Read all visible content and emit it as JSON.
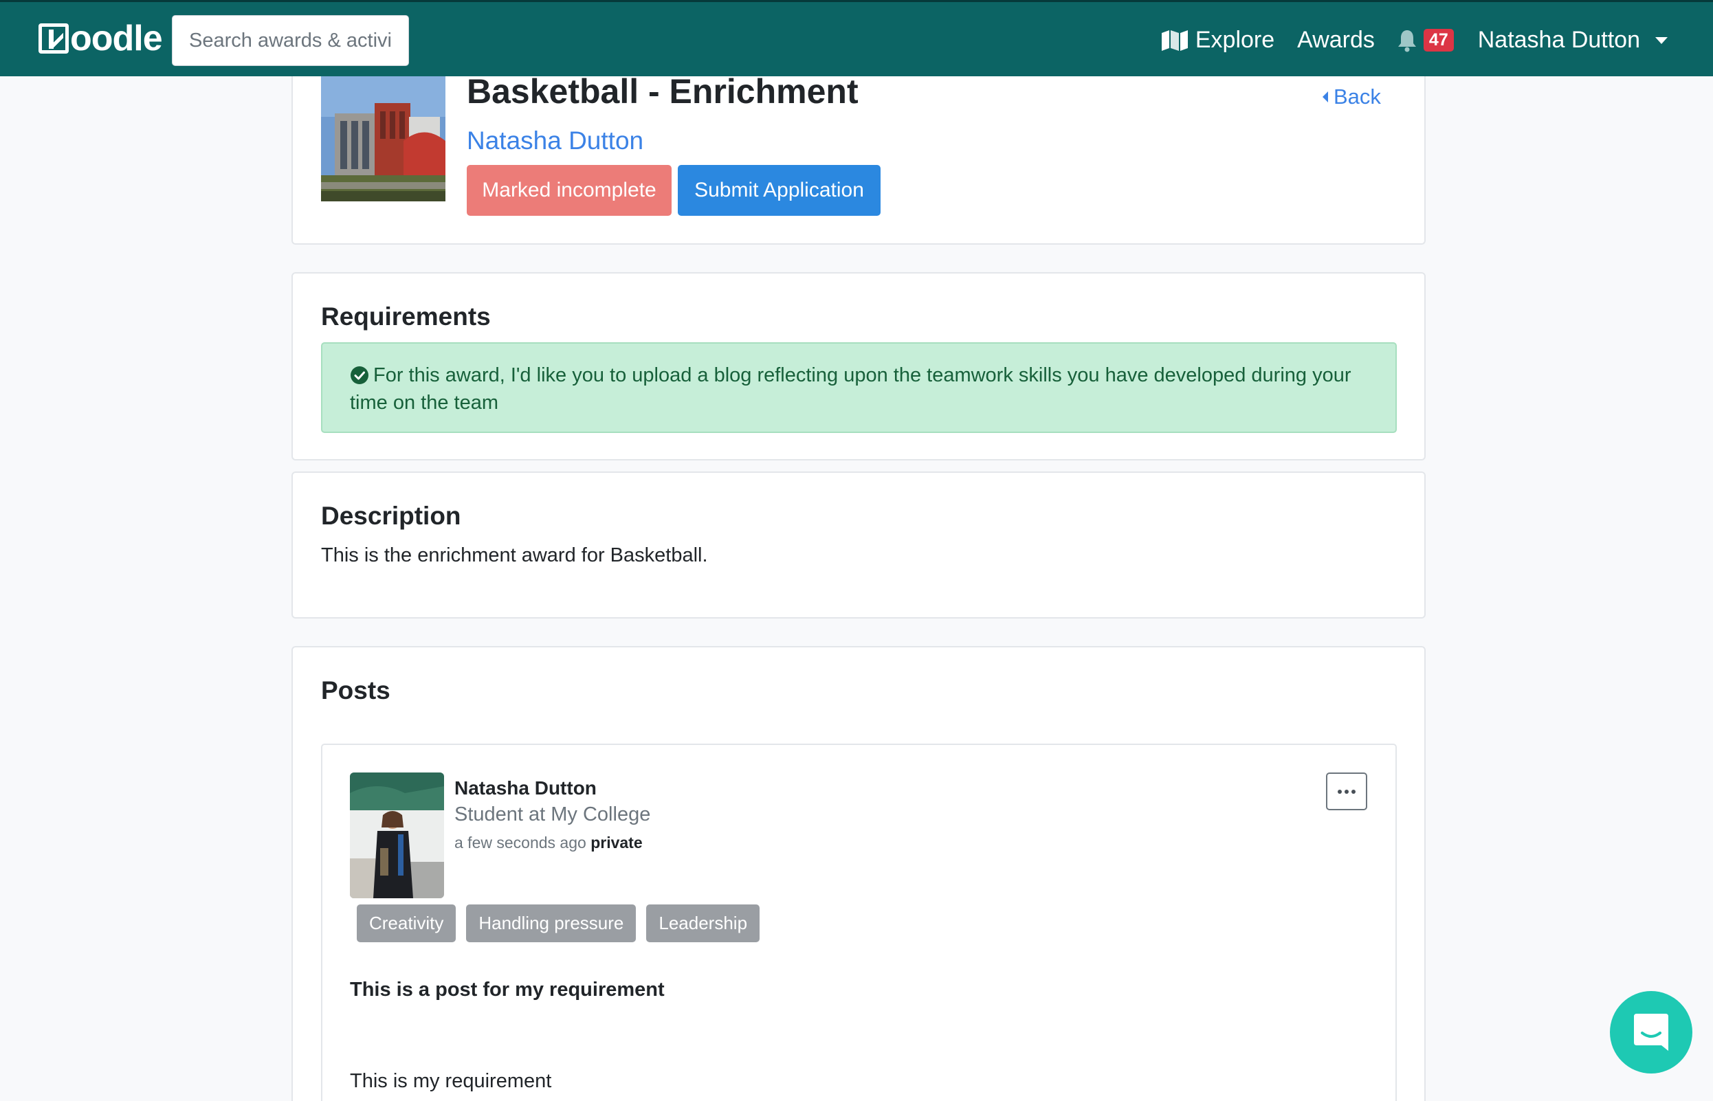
{
  "navbar": {
    "logo": "Kloodle",
    "search_placeholder": "Search awards & activities",
    "explore_label": "Explore",
    "awards_label": "Awards",
    "notification_count": "47",
    "user_name": "Natasha Dutton"
  },
  "award": {
    "title": "Basketball - Enrichment",
    "owner": "Natasha Dutton",
    "status_button": "Marked incomplete",
    "submit_button": "Submit Application",
    "back_label": "Back"
  },
  "requirements": {
    "heading": "Requirements",
    "items": [
      {
        "text": "For this award, I'd like you to upload a blog reflecting upon the teamwork skills you have developed during your time on the team",
        "completed": true
      }
    ]
  },
  "description": {
    "heading": "Description",
    "text": "This is the enrichment award for Basketball."
  },
  "posts": {
    "heading": "Posts",
    "items": [
      {
        "author": "Natasha Dutton",
        "role": "Student at My College",
        "time": "a few seconds ago",
        "visibility": "private",
        "tags": [
          "Creativity",
          "Handling pressure",
          "Leadership"
        ],
        "title": "This is a post for my requirement",
        "body": "This is my requirement"
      }
    ]
  },
  "colors": {
    "navbar": "#0c6464",
    "primary": "#2b88e0",
    "danger_light": "#ec7c78",
    "success_bg": "#c6eed8",
    "tag": "#9a9ea3",
    "chat": "#1ec9b3"
  },
  "icons": [
    "map-icon",
    "bell-icon",
    "chevron-down-icon",
    "chevron-left-icon",
    "check-circle-icon",
    "ellipsis-icon",
    "chat-icon"
  ]
}
